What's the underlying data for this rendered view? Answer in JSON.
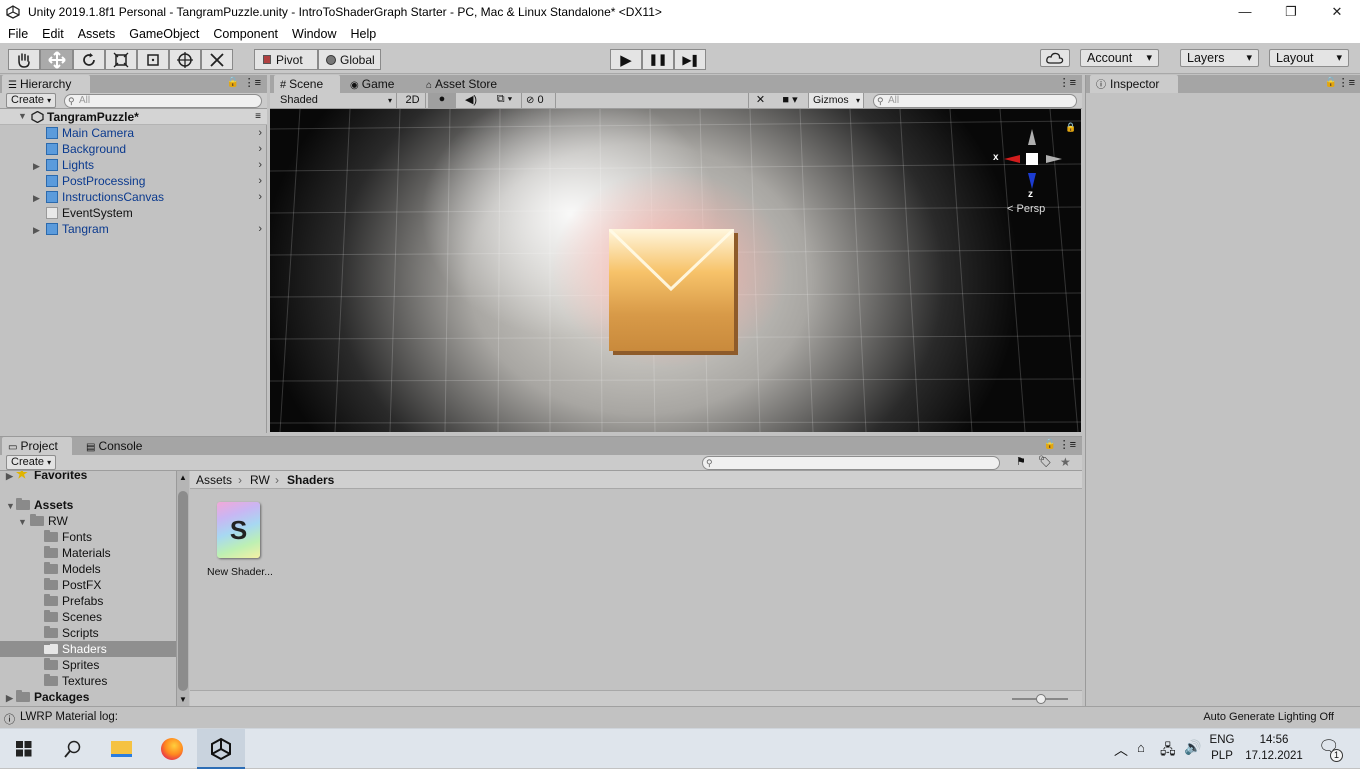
{
  "window": {
    "title": "Unity 2019.1.8f1 Personal - TangramPuzzle.unity - IntroToShaderGraph Starter - PC, Mac & Linux Standalone* <DX11>",
    "minimize": "—",
    "maximize": "❐",
    "close": "✕"
  },
  "menu": [
    "File",
    "Edit",
    "Assets",
    "GameObject",
    "Component",
    "Window",
    "Help"
  ],
  "toolbar": {
    "tools": [
      "hand-tool",
      "move-tool",
      "rotate-tool",
      "scale-tool",
      "rect-tool",
      "transform-tool",
      "custom-tool"
    ],
    "pivot": "Pivot",
    "global": "Global",
    "play": "▶",
    "pause": "❚❚",
    "step": "▶❚",
    "account": "Account",
    "layers": "Layers",
    "layout": "Layout"
  },
  "hierarchy": {
    "tab": "Hierarchy",
    "create": "Create",
    "search_placeholder": "All",
    "scene": "TangramPuzzle*",
    "items": [
      {
        "label": "Main Camera",
        "expandable": false
      },
      {
        "label": "Background",
        "expandable": false
      },
      {
        "label": "Lights",
        "expandable": true
      },
      {
        "label": "PostProcessing",
        "expandable": false
      },
      {
        "label": "InstructionsCanvas",
        "expandable": true
      },
      {
        "label": "EventSystem",
        "expandable": false
      },
      {
        "label": "Tangram",
        "expandable": true
      }
    ]
  },
  "scene_view": {
    "tabs": [
      "Scene",
      "Game",
      "Asset Store"
    ],
    "shading": "Shaded",
    "mode2d": "2D",
    "hidden_count": "0",
    "gizmos": "Gizmos",
    "search_placeholder": "All",
    "axis_x": "x",
    "axis_z": "z",
    "projection": "Persp"
  },
  "inspector": {
    "tab": "Inspector"
  },
  "project": {
    "tabs": [
      "Project",
      "Console"
    ],
    "create": "Create",
    "favorites": "Favorites",
    "assets": "Assets",
    "rw": "RW",
    "folders": [
      "Fonts",
      "Materials",
      "Models",
      "PostFX",
      "Prefabs",
      "Scenes",
      "Scripts",
      "Shaders",
      "Sprites",
      "Textures"
    ],
    "selected_folder": "Shaders",
    "packages": "Packages",
    "breadcrumb": [
      "Assets",
      "RW",
      "Shaders"
    ],
    "asset": {
      "label": "New Shader...",
      "glyph": "S"
    }
  },
  "status": {
    "left": "LWRP Material log:",
    "right": "Auto Generate Lighting Off"
  },
  "taskbar": {
    "lang1": "ENG",
    "lang2": "PLP",
    "time": "14:56",
    "date": "17.12.2021",
    "notif": "1"
  }
}
